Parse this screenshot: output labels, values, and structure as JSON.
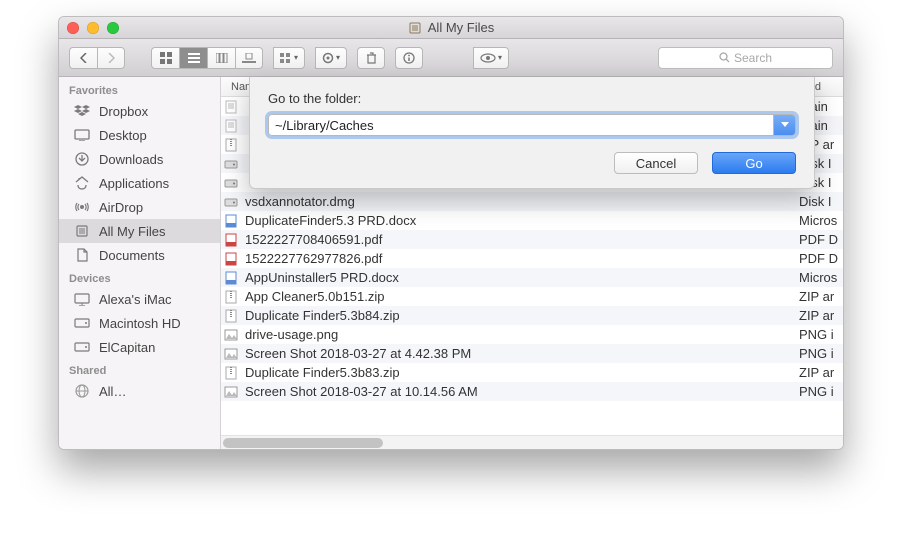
{
  "window": {
    "title": "All My Files"
  },
  "toolbar": {
    "search_placeholder": "Search"
  },
  "sidebar": {
    "sections": [
      {
        "title": "Favorites",
        "items": [
          {
            "label": "Dropbox",
            "icon": "dropbox"
          },
          {
            "label": "Desktop",
            "icon": "desktop"
          },
          {
            "label": "Downloads",
            "icon": "downloads"
          },
          {
            "label": "Applications",
            "icon": "applications"
          },
          {
            "label": "AirDrop",
            "icon": "airdrop"
          },
          {
            "label": "All My Files",
            "icon": "allfiles",
            "selected": true
          },
          {
            "label": "Documents",
            "icon": "documents"
          }
        ]
      },
      {
        "title": "Devices",
        "items": [
          {
            "label": "Alexa's iMac",
            "icon": "imac"
          },
          {
            "label": "Macintosh HD",
            "icon": "hdd"
          },
          {
            "label": "ElCapitan",
            "icon": "hdd"
          }
        ]
      },
      {
        "title": "Shared",
        "items": [
          {
            "label": "All…",
            "icon": "network"
          }
        ]
      }
    ]
  },
  "columns": {
    "name": "Name",
    "kind": "Kind"
  },
  "files": [
    {
      "name": "",
      "kind": "Plain",
      "icon": "txt"
    },
    {
      "name": "",
      "kind": "Plain",
      "icon": "txt"
    },
    {
      "name": "",
      "kind": "ZIP ar",
      "icon": "zip"
    },
    {
      "name": "",
      "kind": "Disk I",
      "icon": "dmg"
    },
    {
      "name": "",
      "kind": "Disk I",
      "icon": "dmg"
    },
    {
      "name": "vsdxannotator.dmg",
      "kind": "Disk I",
      "icon": "dmg"
    },
    {
      "name": "DuplicateFinder5.3 PRD.docx",
      "kind": "Micros",
      "icon": "docx"
    },
    {
      "name": "1522227708406591.pdf",
      "kind": "PDF D",
      "icon": "pdf"
    },
    {
      "name": "1522227762977826.pdf",
      "kind": "PDF D",
      "icon": "pdf"
    },
    {
      "name": "AppUninstaller5 PRD.docx",
      "kind": "Micros",
      "icon": "docx"
    },
    {
      "name": "App Cleaner5.0b151.zip",
      "kind": "ZIP ar",
      "icon": "zip"
    },
    {
      "name": "Duplicate Finder5.3b84.zip",
      "kind": "ZIP ar",
      "icon": "zip"
    },
    {
      "name": "drive-usage.png",
      "kind": "PNG i",
      "icon": "png"
    },
    {
      "name": "Screen Shot 2018-03-27 at 4.42.38 PM",
      "kind": "PNG i",
      "icon": "png"
    },
    {
      "name": "Duplicate Finder5.3b83.zip",
      "kind": "ZIP ar",
      "icon": "zip"
    },
    {
      "name": "Screen Shot 2018-03-27 at 10.14.56 AM",
      "kind": "PNG i",
      "icon": "png"
    }
  ],
  "sheet": {
    "label": "Go to the folder:",
    "value": "~/Library/Caches",
    "cancel": "Cancel",
    "go": "Go"
  }
}
